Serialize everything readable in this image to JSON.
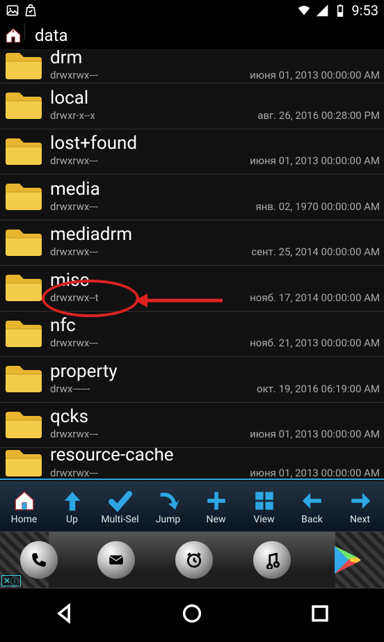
{
  "status": {
    "time": "9:53"
  },
  "path": {
    "current": "data"
  },
  "folders": [
    {
      "name": "drm",
      "perms": "drwxrwx---",
      "date": "июня 01, 2013 00:00:00 AM"
    },
    {
      "name": "local",
      "perms": "drwxr-x--x",
      "date": "авг. 26, 2016 00:28:00 PM"
    },
    {
      "name": "lost+found",
      "perms": "drwxrwx---",
      "date": "июня 01, 2013 00:00:00 AM"
    },
    {
      "name": "media",
      "perms": "drwxrwx---",
      "date": "янв. 02, 1970 00:00:00 AM"
    },
    {
      "name": "mediadrm",
      "perms": "drwxrwx---",
      "date": "сент. 25, 2014 00:00:00 AM"
    },
    {
      "name": "misc",
      "perms": "drwxrwx--t",
      "date": "нояб. 17, 2014 00:00:00 AM"
    },
    {
      "name": "nfc",
      "perms": "drwxrwx---",
      "date": "нояб. 21, 2013 00:00:00 AM"
    },
    {
      "name": "property",
      "perms": "drwx------",
      "date": "окт. 19, 2016 06:19:00 AM"
    },
    {
      "name": "qcks",
      "perms": "drwxrwx---",
      "date": "июня 01, 2013 00:00:00 AM"
    },
    {
      "name": "resource-cache",
      "perms": "drwxrwx---",
      "date": "июня 01, 2013 00:00:00 AM"
    }
  ],
  "toolbar": {
    "home": "Home",
    "up": "Up",
    "multi": "Multi-Sel",
    "jump": "Jump",
    "new": "New",
    "view": "View",
    "back": "Back",
    "next": "Next"
  },
  "ad": {
    "close": "✕",
    "info": "ⓘ"
  }
}
